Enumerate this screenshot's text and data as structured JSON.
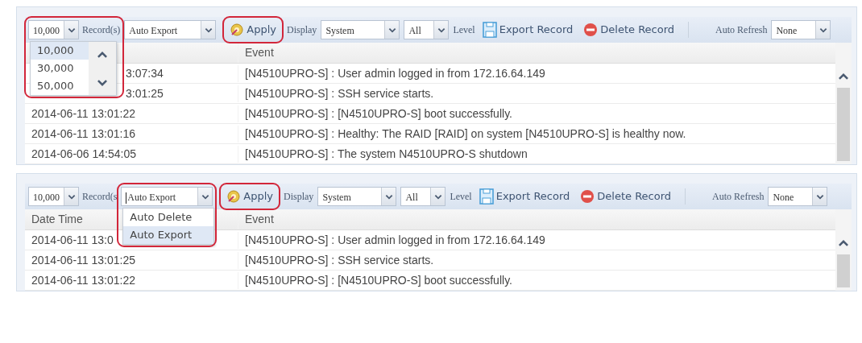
{
  "panels": [
    {
      "toolbar": {
        "records_select": {
          "value": "10,000",
          "focused": false,
          "highlighted": true,
          "menu": {
            "scrollable": true,
            "options": [
              {
                "label": "10,000",
                "selected": true
              },
              {
                "label": "30,000",
                "selected": false
              },
              {
                "label": "50,000",
                "selected": false
              }
            ]
          }
        },
        "records_label": "Record(s)",
        "action_select": {
          "value": "Auto Export",
          "focused": false,
          "highlighted": false
        },
        "apply_button": {
          "label": "Apply",
          "highlighted": true
        },
        "display_label": "Display",
        "display_select": {
          "value": "System"
        },
        "level_select": {
          "value": "All"
        },
        "level_label": "Level",
        "export_button": "Export Record",
        "delete_button": "Delete Record",
        "refresh_label": "Auto Refresh",
        "refresh_select": {
          "value": "None"
        }
      },
      "table": {
        "columns": {
          "event": "Event"
        },
        "rows": [
          {
            "date": "3:07:34",
            "covered": true,
            "event": "[N4510UPRO-S] : User admin logged in from 172.16.64.149"
          },
          {
            "date": "3:01:25",
            "covered": true,
            "event": "[N4510UPRO-S] : SSH service starts."
          },
          {
            "date": "2014-06-11 13:01:22",
            "event": "[N4510UPRO-S] : [N4510UPRO-S] boot successfully."
          },
          {
            "date": "2014-06-11 13:01:16",
            "event": "[N4510UPRO-S] : Healthy: The RAID [RAID] on system [N4510UPRO-S] is healthy now."
          },
          {
            "date": "2014-06-06 14:54:05",
            "event": "[N4510UPRO-S] : The system N4510UPRO-S shutdown"
          }
        ]
      }
    },
    {
      "toolbar": {
        "records_select": {
          "value": "10,000",
          "focused": false,
          "highlighted": false
        },
        "records_label": "Record(s",
        "action_select": {
          "value": "Auto Export",
          "focused": true,
          "highlighted": true,
          "menu": {
            "scrollable": false,
            "options": [
              {
                "label": "Auto Delete",
                "selected": false
              },
              {
                "label": "Auto Export",
                "selected": true
              }
            ]
          }
        },
        "apply_button": {
          "label": "Apply",
          "highlighted": true
        },
        "display_label": "Display",
        "display_select": {
          "value": "System"
        },
        "level_select": {
          "value": "All"
        },
        "level_label": "Level",
        "export_button": "Export Record",
        "delete_button": "Delete Record",
        "refresh_label": "Auto Refresh",
        "refresh_select": {
          "value": "None"
        }
      },
      "table": {
        "columns": {
          "date_time": "Date Time",
          "event": "Event"
        },
        "rows": [
          {
            "date": "2014-06-11 13:0",
            "event": "[N4510UPRO-S] : User admin logged in from 172.16.64.149"
          },
          {
            "date": "2014-06-11 13:01:25",
            "event": "[N4510UPRO-S] : SSH service starts."
          },
          {
            "date": "2014-06-11 13:01:22",
            "event": "[N4510UPRO-S] : [N4510UPRO-S] boot successfully."
          }
        ]
      }
    }
  ]
}
